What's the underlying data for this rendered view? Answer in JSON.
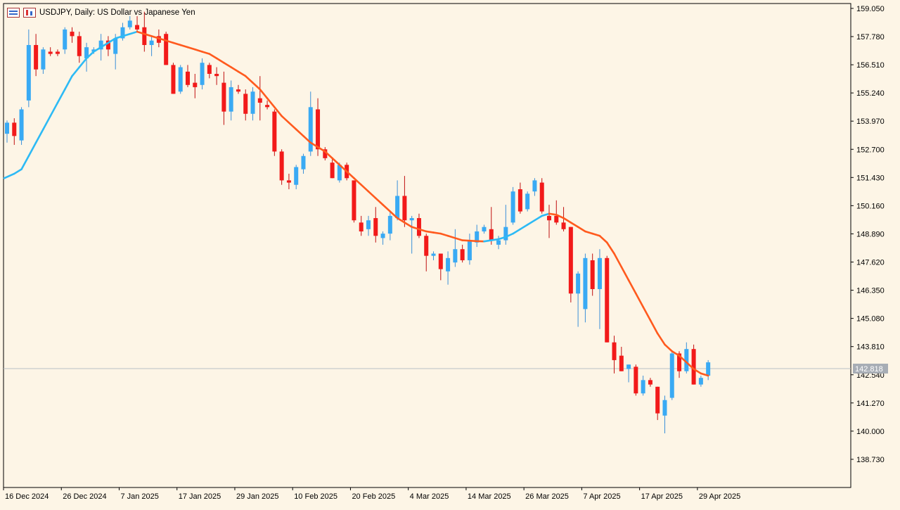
{
  "window": {
    "title": "USDJPY, Daily:  US Dollar vs Japanese Yen",
    "icons": [
      "chart-bars-icon",
      "candles-icon"
    ]
  },
  "chart_data": {
    "type": "candlestick",
    "symbol": "USDJPY",
    "timeframe": "Daily",
    "title": "USDJPY, Daily:  US Dollar vs Japanese Yen",
    "ylim": [
      137.46,
      159.27
    ],
    "y_ticks": [
      "159.050",
      "157.780",
      "156.510",
      "155.240",
      "153.970",
      "152.700",
      "151.430",
      "150.160",
      "148.890",
      "147.620",
      "146.350",
      "145.080",
      "143.810",
      "142.540",
      "141.270",
      "140.000",
      "138.730"
    ],
    "x_tick_labels": [
      "16 Dec 2024",
      "26 Dec 2024",
      "7 Jan 2025",
      "17 Jan 2025",
      "29 Jan 2025",
      "10 Feb 2025",
      "20 Feb 2025",
      "4 Mar 2025",
      "14 Mar 2025",
      "26 Mar 2025",
      "7 Apr 2025",
      "17 Apr 2025",
      "29 Apr 2025"
    ],
    "current_price": "142.818",
    "colors": {
      "background": "#fdf5e6",
      "bull": "#39aaf4",
      "bear": "#f21a1a",
      "ma_rising": "#2dbaf5",
      "ma_falling": "#ff5a1e",
      "grid": "#000000",
      "price_line": "#b9bec5",
      "price_tag": "#a7adb5"
    },
    "candles": [
      {
        "o": 153.4,
        "h": 154.0,
        "l": 153.0,
        "c": 153.9
      },
      {
        "o": 153.9,
        "h": 154.1,
        "l": 152.9,
        "c": 153.3
      },
      {
        "o": 153.1,
        "h": 154.6,
        "l": 152.9,
        "c": 154.5
      },
      {
        "o": 154.9,
        "h": 158.1,
        "l": 154.6,
        "c": 157.4
      },
      {
        "o": 157.4,
        "h": 157.9,
        "l": 156.0,
        "c": 156.3
      },
      {
        "o": 156.3,
        "h": 157.3,
        "l": 156.1,
        "c": 157.2
      },
      {
        "o": 157.1,
        "h": 157.3,
        "l": 156.9,
        "c": 157.0
      },
      {
        "o": 157.1,
        "h": 157.2,
        "l": 156.9,
        "c": 157.0
      },
      {
        "o": 157.2,
        "h": 158.2,
        "l": 157.0,
        "c": 158.1
      },
      {
        "o": 158.0,
        "h": 158.2,
        "l": 157.5,
        "c": 157.8
      },
      {
        "o": 157.8,
        "h": 158.0,
        "l": 156.6,
        "c": 156.9
      },
      {
        "o": 156.8,
        "h": 157.5,
        "l": 156.2,
        "c": 157.3
      },
      {
        "o": 157.1,
        "h": 157.3,
        "l": 157.0,
        "c": 157.2
      },
      {
        "o": 157.2,
        "h": 157.9,
        "l": 156.7,
        "c": 157.6
      },
      {
        "o": 157.6,
        "h": 157.8,
        "l": 156.9,
        "c": 157.2
      },
      {
        "o": 157.0,
        "h": 157.9,
        "l": 156.3,
        "c": 157.7
      },
      {
        "o": 157.7,
        "h": 158.4,
        "l": 157.6,
        "c": 158.2
      },
      {
        "o": 158.2,
        "h": 158.7,
        "l": 158.1,
        "c": 158.5
      },
      {
        "o": 158.3,
        "h": 158.7,
        "l": 158.0,
        "c": 158.1
      },
      {
        "o": 158.2,
        "h": 158.9,
        "l": 157.1,
        "c": 157.4
      },
      {
        "o": 157.4,
        "h": 157.8,
        "l": 156.9,
        "c": 157.6
      },
      {
        "o": 157.8,
        "h": 158.1,
        "l": 157.3,
        "c": 157.5
      },
      {
        "o": 157.9,
        "h": 158.0,
        "l": 156.5,
        "c": 156.5
      },
      {
        "o": 156.5,
        "h": 156.6,
        "l": 155.2,
        "c": 155.2
      },
      {
        "o": 155.3,
        "h": 156.5,
        "l": 155.2,
        "c": 156.4
      },
      {
        "o": 156.2,
        "h": 156.5,
        "l": 155.5,
        "c": 155.6
      },
      {
        "o": 155.7,
        "h": 156.1,
        "l": 155.0,
        "c": 155.5
      },
      {
        "o": 155.6,
        "h": 156.8,
        "l": 155.4,
        "c": 156.6
      },
      {
        "o": 156.5,
        "h": 156.6,
        "l": 155.9,
        "c": 156.1
      },
      {
        "o": 156.1,
        "h": 156.4,
        "l": 155.6,
        "c": 156.0
      },
      {
        "o": 155.7,
        "h": 156.2,
        "l": 153.8,
        "c": 154.4
      },
      {
        "o": 154.4,
        "h": 155.8,
        "l": 154.0,
        "c": 155.5
      },
      {
        "o": 155.4,
        "h": 155.6,
        "l": 155.2,
        "c": 155.3
      },
      {
        "o": 155.2,
        "h": 155.4,
        "l": 154.0,
        "c": 154.3
      },
      {
        "o": 154.3,
        "h": 155.5,
        "l": 154.0,
        "c": 155.3
      },
      {
        "o": 155.0,
        "h": 156.0,
        "l": 154.0,
        "c": 154.8
      },
      {
        "o": 154.7,
        "h": 154.9,
        "l": 154.5,
        "c": 154.6
      },
      {
        "o": 154.4,
        "h": 154.5,
        "l": 152.4,
        "c": 152.6
      },
      {
        "o": 152.6,
        "h": 152.7,
        "l": 151.1,
        "c": 151.3
      },
      {
        "o": 151.3,
        "h": 151.6,
        "l": 150.9,
        "c": 151.2
      },
      {
        "o": 151.1,
        "h": 152.0,
        "l": 150.9,
        "c": 151.9
      },
      {
        "o": 151.8,
        "h": 152.5,
        "l": 151.6,
        "c": 152.4
      },
      {
        "o": 152.6,
        "h": 155.3,
        "l": 152.4,
        "c": 154.6
      },
      {
        "o": 154.5,
        "h": 155.0,
        "l": 152.4,
        "c": 152.7
      },
      {
        "o": 152.7,
        "h": 152.8,
        "l": 152.2,
        "c": 152.3
      },
      {
        "o": 152.1,
        "h": 152.3,
        "l": 151.4,
        "c": 151.4
      },
      {
        "o": 151.3,
        "h": 152.1,
        "l": 151.2,
        "c": 152.0
      },
      {
        "o": 152.0,
        "h": 152.1,
        "l": 151.3,
        "c": 151.4
      },
      {
        "o": 151.3,
        "h": 151.3,
        "l": 149.4,
        "c": 149.5
      },
      {
        "o": 149.4,
        "h": 149.7,
        "l": 148.8,
        "c": 149.0
      },
      {
        "o": 149.1,
        "h": 149.7,
        "l": 148.8,
        "c": 149.5
      },
      {
        "o": 149.6,
        "h": 150.1,
        "l": 148.5,
        "c": 148.8
      },
      {
        "o": 148.7,
        "h": 149.0,
        "l": 148.4,
        "c": 148.9
      },
      {
        "o": 148.9,
        "h": 149.9,
        "l": 148.6,
        "c": 149.7
      },
      {
        "o": 149.6,
        "h": 151.3,
        "l": 149.5,
        "c": 150.6
      },
      {
        "o": 150.6,
        "h": 151.5,
        "l": 149.2,
        "c": 149.5
      },
      {
        "o": 149.5,
        "h": 149.7,
        "l": 148.0,
        "c": 149.6
      },
      {
        "o": 149.6,
        "h": 149.8,
        "l": 148.7,
        "c": 148.8
      },
      {
        "o": 148.8,
        "h": 148.9,
        "l": 147.2,
        "c": 147.9
      },
      {
        "o": 147.9,
        "h": 148.1,
        "l": 147.7,
        "c": 148.0
      },
      {
        "o": 148.0,
        "h": 148.0,
        "l": 146.8,
        "c": 147.3
      },
      {
        "o": 147.2,
        "h": 148.1,
        "l": 146.6,
        "c": 147.8
      },
      {
        "o": 147.6,
        "h": 149.1,
        "l": 147.4,
        "c": 148.2
      },
      {
        "o": 148.2,
        "h": 148.4,
        "l": 147.6,
        "c": 147.7
      },
      {
        "o": 147.7,
        "h": 148.9,
        "l": 147.5,
        "c": 148.6
      },
      {
        "o": 148.5,
        "h": 149.3,
        "l": 148.3,
        "c": 149.0
      },
      {
        "o": 149.0,
        "h": 149.3,
        "l": 148.9,
        "c": 149.2
      },
      {
        "o": 149.1,
        "h": 150.1,
        "l": 148.4,
        "c": 148.6
      },
      {
        "o": 148.4,
        "h": 148.8,
        "l": 148.2,
        "c": 148.6
      },
      {
        "o": 148.6,
        "h": 150.2,
        "l": 148.4,
        "c": 149.2
      },
      {
        "o": 149.4,
        "h": 151.0,
        "l": 149.3,
        "c": 150.8
      },
      {
        "o": 150.9,
        "h": 151.2,
        "l": 149.8,
        "c": 149.9
      },
      {
        "o": 150.0,
        "h": 150.8,
        "l": 149.9,
        "c": 150.7
      },
      {
        "o": 150.8,
        "h": 151.4,
        "l": 150.6,
        "c": 151.3
      },
      {
        "o": 151.2,
        "h": 151.4,
        "l": 149.8,
        "c": 149.9
      },
      {
        "o": 149.7,
        "h": 150.2,
        "l": 148.7,
        "c": 149.5
      },
      {
        "o": 149.7,
        "h": 150.4,
        "l": 149.3,
        "c": 149.4
      },
      {
        "o": 149.4,
        "h": 150.1,
        "l": 149.0,
        "c": 149.1
      },
      {
        "o": 149.2,
        "h": 149.2,
        "l": 145.8,
        "c": 146.2
      },
      {
        "o": 146.2,
        "h": 147.2,
        "l": 144.7,
        "c": 147.1
      },
      {
        "o": 145.5,
        "h": 148.0,
        "l": 144.9,
        "c": 147.8
      },
      {
        "o": 147.7,
        "h": 148.0,
        "l": 146.1,
        "c": 146.4
      },
      {
        "o": 146.4,
        "h": 148.2,
        "l": 144.6,
        "c": 147.8
      },
      {
        "o": 147.8,
        "h": 147.9,
        "l": 144.0,
        "c": 144.0
      },
      {
        "o": 144.0,
        "h": 144.3,
        "l": 142.6,
        "c": 143.2
      },
      {
        "o": 143.4,
        "h": 143.8,
        "l": 142.7,
        "c": 142.7
      },
      {
        "o": 142.8,
        "h": 143.0,
        "l": 142.2,
        "c": 143.0
      },
      {
        "o": 142.9,
        "h": 143.0,
        "l": 141.6,
        "c": 141.7
      },
      {
        "o": 141.7,
        "h": 142.5,
        "l": 141.6,
        "c": 142.3
      },
      {
        "o": 142.3,
        "h": 142.4,
        "l": 142.0,
        "c": 142.1
      },
      {
        "o": 142.0,
        "h": 142.0,
        "l": 140.5,
        "c": 140.8
      },
      {
        "o": 140.7,
        "h": 141.6,
        "l": 139.9,
        "c": 141.4
      },
      {
        "o": 141.5,
        "h": 143.6,
        "l": 141.4,
        "c": 143.5
      },
      {
        "o": 143.5,
        "h": 143.6,
        "l": 142.4,
        "c": 142.7
      },
      {
        "o": 142.7,
        "h": 144.0,
        "l": 142.6,
        "c": 143.7
      },
      {
        "o": 143.7,
        "h": 143.9,
        "l": 142.1,
        "c": 142.1
      },
      {
        "o": 142.1,
        "h": 142.5,
        "l": 142.0,
        "c": 142.4
      },
      {
        "o": 142.5,
        "h": 143.2,
        "l": 142.3,
        "c": 143.1
      }
    ],
    "moving_average": [
      151.4,
      151.6,
      151.8,
      152.4,
      153.0,
      153.6,
      154.2,
      154.8,
      155.4,
      156.0,
      156.4,
      156.8,
      157.1,
      157.3,
      157.5,
      157.7,
      157.8,
      157.9,
      158.0,
      157.9,
      157.8,
      157.7,
      157.6,
      157.5,
      157.4,
      157.3,
      157.2,
      157.1,
      157.0,
      156.8,
      156.6,
      156.4,
      156.2,
      156.0,
      155.7,
      155.4,
      155.0,
      154.6,
      154.2,
      153.9,
      153.6,
      153.3,
      153.0,
      152.8,
      152.6,
      152.3,
      152.0,
      151.7,
      151.4,
      151.1,
      150.8,
      150.5,
      150.2,
      149.9,
      149.6,
      149.4,
      149.2,
      149.1,
      149.0,
      148.95,
      148.9,
      148.8,
      148.7,
      148.6,
      148.58,
      148.56,
      148.55,
      148.6,
      148.65,
      148.75,
      148.9,
      149.1,
      149.3,
      149.5,
      149.7,
      149.8,
      149.75,
      149.6,
      149.4,
      149.2,
      149.0,
      148.9,
      148.8,
      148.5,
      148.0,
      147.4,
      146.8,
      146.2,
      145.6,
      145.0,
      144.4,
      143.9,
      143.6,
      143.4,
      143.1,
      142.8,
      142.6,
      142.5
    ]
  }
}
